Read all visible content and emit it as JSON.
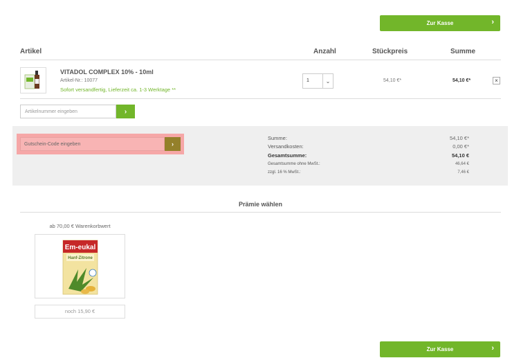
{
  "checkout": {
    "label": "Zur Kasse",
    "chevron": "›"
  },
  "table": {
    "headers": {
      "article": "Artikel",
      "quantity": "Anzahl",
      "unit_price": "Stückpreis",
      "sum": "Summe"
    }
  },
  "product": {
    "title": "VITADOL COMPLEX 10% - 10ml",
    "sku": "Artikel-Nr.: 10077",
    "shipping": "Sofort versandfertig, Lieferzeit ca. 1-3 Werktage **",
    "quantity": "1",
    "unit_price": "54,10 €*",
    "sum": "54,10 €*",
    "remove": "×"
  },
  "article_input": {
    "placeholder": "Artikelnummer eingeben",
    "button": "›"
  },
  "coupon": {
    "placeholder": "Gutschein-Code eingeben",
    "button": "›"
  },
  "summary": {
    "rows": [
      {
        "label": "Summe:",
        "value": "54,10 €*"
      },
      {
        "label": "Versandkosten:",
        "value": "0,00 €*"
      },
      {
        "label": "Gesamtsumme:",
        "value": "54,10 €"
      },
      {
        "label": "Gesamtsumme ohne MwSt.:",
        "value": "46,64 €"
      },
      {
        "label": "zzgl. 16 % MwSt.:",
        "value": "7,46 €"
      }
    ]
  },
  "premium": {
    "title": "Prämie wählen",
    "threshold": "ab 70,00 € Warenkorbwert",
    "remaining": "noch 15,90 €",
    "product_brand": "Em-eukal",
    "product_variant": "Hanf-Zitrone"
  },
  "colors": {
    "accent": "#72b62a",
    "panel": "#efefef",
    "coupon_highlight": "#f6a7a7",
    "coupon_button": "#94802a"
  }
}
